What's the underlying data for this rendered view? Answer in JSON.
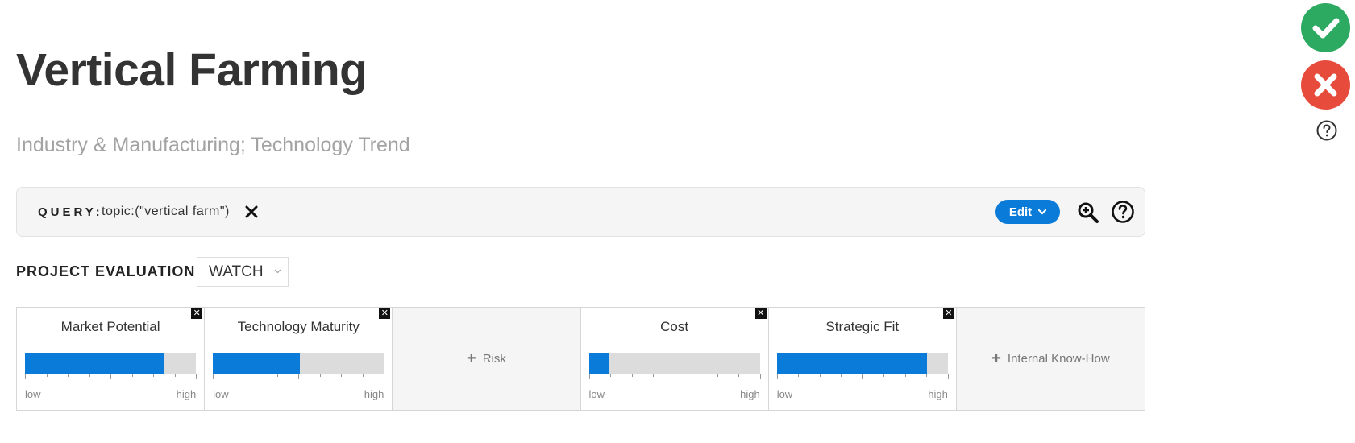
{
  "header": {
    "title": "Vertical Farming",
    "subtitle": "Industry & Manufacturing; Technology Trend"
  },
  "query": {
    "label": "QUERY:",
    "text": "topic:(\"vertical farm\")",
    "clear_icon": "close-icon",
    "edit_label": "Edit",
    "edit_icon": "chevron-down-icon",
    "zoom_icon": "zoom-in-icon",
    "help_icon": "help-icon"
  },
  "evaluation": {
    "label": "PROJECT EVALUATION:",
    "selected": "WATCH"
  },
  "criteria": [
    {
      "name": "Market Potential",
      "level": 0.81,
      "low": "low",
      "high": "high",
      "removable": true
    },
    {
      "name": "Technology Maturity",
      "level": 0.51,
      "low": "low",
      "high": "high",
      "removable": true
    },
    {
      "name": "Risk",
      "empty": true
    },
    {
      "name": "Cost",
      "level": 0.12,
      "low": "low",
      "high": "high",
      "removable": true
    },
    {
      "name": "Strategic Fit",
      "level": 0.88,
      "low": "low",
      "high": "high",
      "removable": true
    },
    {
      "name": "Internal Know-How",
      "empty": true
    }
  ],
  "side_actions": {
    "accept_icon": "checkmark-icon",
    "reject_icon": "close-icon",
    "help_icon": "help-icon"
  },
  "colors": {
    "accent": "#0a7bd8",
    "accept": "#2daa62",
    "reject": "#e64b3c",
    "bar_track": "#dcdcdc"
  }
}
